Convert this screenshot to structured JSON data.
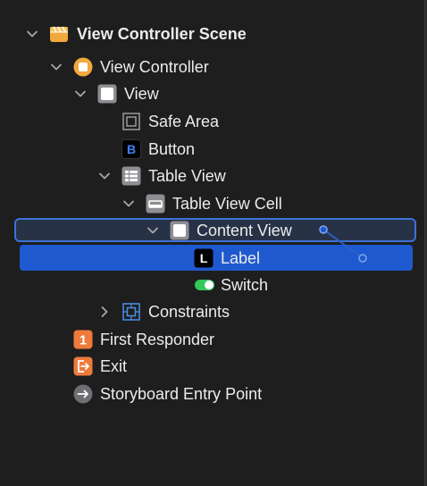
{
  "tree": {
    "scene": {
      "label": "View Controller Scene",
      "icon": "scene-icon"
    },
    "view_controller": {
      "label": "View Controller",
      "icon": "view-controller-icon"
    },
    "view": {
      "label": "View",
      "icon": "view-icon"
    },
    "safe_area": {
      "label": "Safe Area",
      "icon": "safe-area-icon"
    },
    "button": {
      "label": "Button",
      "icon": "button-icon",
      "glyph": "B"
    },
    "table_view": {
      "label": "Table View",
      "icon": "table-view-icon"
    },
    "table_view_cell": {
      "label": "Table View Cell",
      "icon": "table-view-cell-icon"
    },
    "content_view": {
      "label": "Content View",
      "icon": "content-view-icon"
    },
    "label": {
      "label": "Label",
      "icon": "label-icon",
      "glyph": "L"
    },
    "switch": {
      "label": "Switch",
      "icon": "switch-icon"
    },
    "constraints": {
      "label": "Constraints",
      "icon": "constraints-icon"
    },
    "first_responder": {
      "label": "First Responder",
      "icon": "first-responder-icon",
      "glyph": "1"
    },
    "exit": {
      "label": "Exit",
      "icon": "exit-icon"
    },
    "entry_point": {
      "label": "Storyboard Entry Point",
      "icon": "arrow-right-icon"
    }
  },
  "colors": {
    "background": "#1e1e1e",
    "selection": "#1f59cf",
    "drop_target_outline": "#3d72d6",
    "scene_orange": "#f2a93b",
    "responder_orange": "#ee7b3c",
    "switch_green": "#34c759"
  }
}
